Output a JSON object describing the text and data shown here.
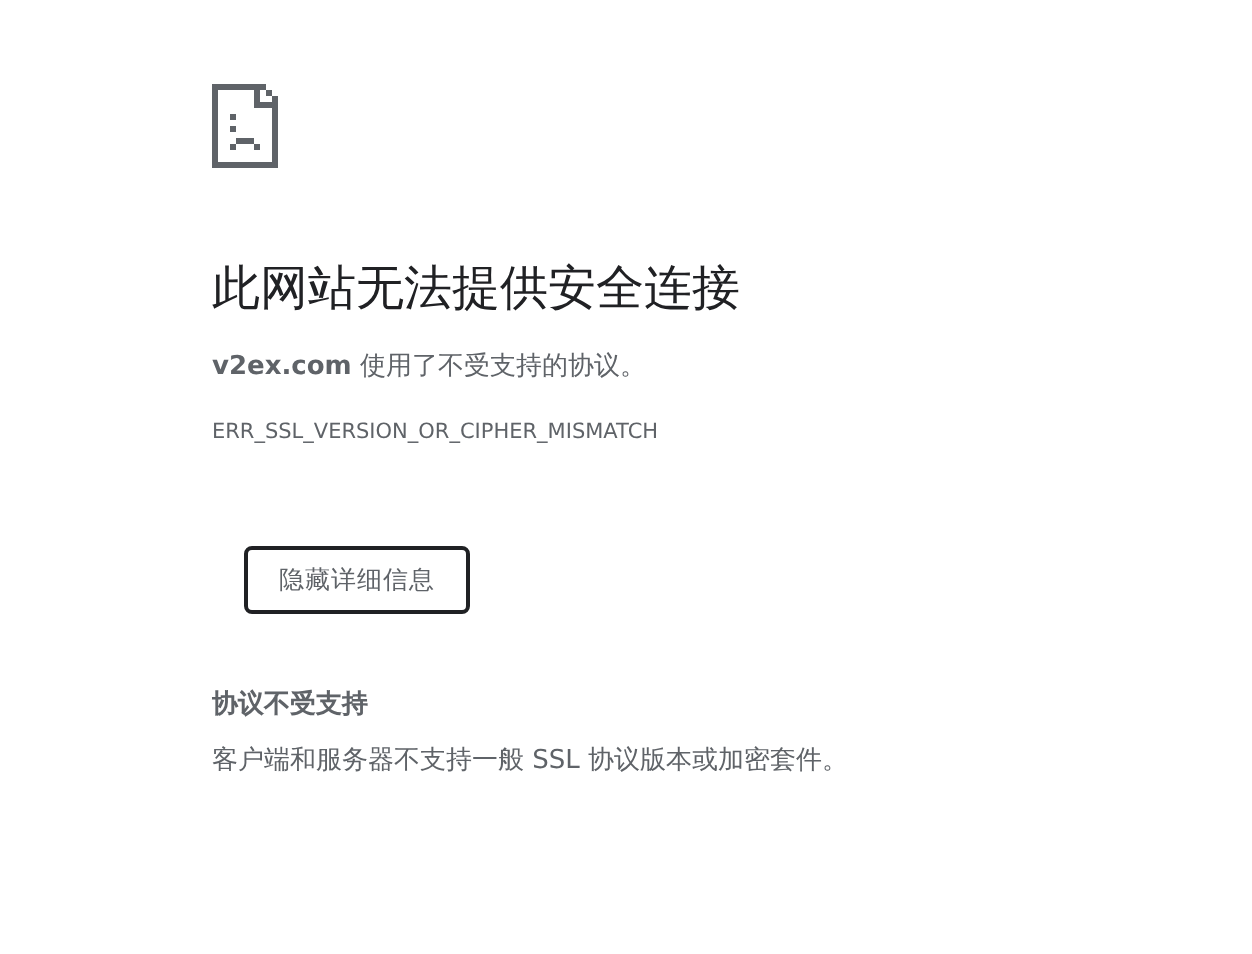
{
  "heading": "此网站无法提供安全连接",
  "summary": "**v2ex.com** 使用了不受支持的协议。",
  "error_code": "ERR_SSL_VERSION_OR_CIPHER_MISMATCH",
  "details_button": {
    "label": "隐藏详细信息",
    "focused": true
  },
  "details": {
    "title": "协议不受支持",
    "text": "客户端和服务器不支持一般 SSL 协议版本或加密套件。"
  }
}
